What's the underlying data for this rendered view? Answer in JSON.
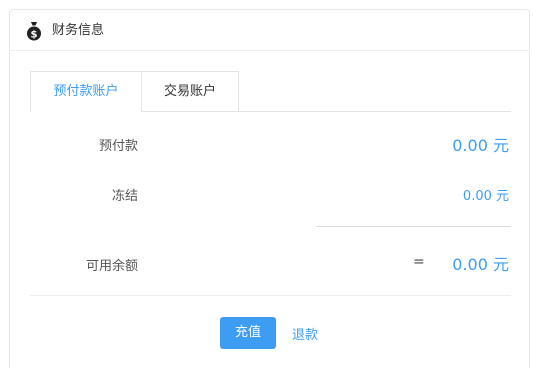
{
  "header": {
    "title": "财务信息",
    "icon": "money-bag-icon"
  },
  "tabs": [
    {
      "label": "预付款账户",
      "active": true
    },
    {
      "label": "交易账户",
      "active": false
    }
  ],
  "rows": {
    "prepaid": {
      "label": "预付款",
      "amount": "0.00 元"
    },
    "frozen": {
      "label": "冻结",
      "amount": "0.00 元"
    },
    "available": {
      "label": "可用余额",
      "operator": "=",
      "amount": "0.00 元"
    }
  },
  "actions": {
    "recharge_label": "充值",
    "refund_label": "退款"
  },
  "colors": {
    "accent": "#3d9df3",
    "border": "#e8e8e8"
  }
}
